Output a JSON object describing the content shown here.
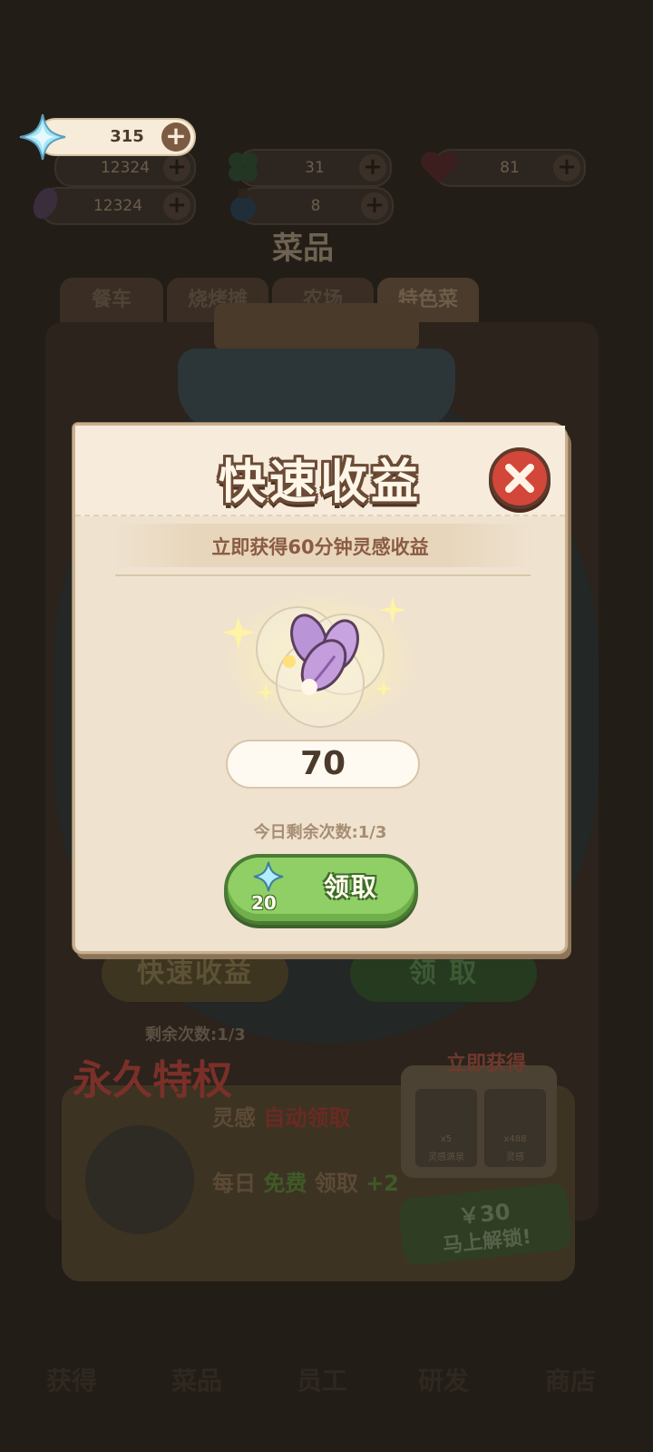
{
  "currency_top": {
    "diamonds": "315"
  },
  "background": {
    "resources": [
      {
        "name": "coins",
        "value": "12324"
      },
      {
        "name": "clover",
        "value": "31"
      },
      {
        "name": "heart",
        "value": "81"
      },
      {
        "name": "inspiration",
        "value": "12324"
      },
      {
        "name": "potion",
        "value": "8"
      }
    ],
    "section_title": "菜品",
    "tabs": [
      "餐车",
      "烧烤摊",
      "农场",
      "特色菜"
    ],
    "quick_income_button": "快速收益",
    "claim_button": "领 取",
    "remaining_count": "剩余次数:1/3",
    "promo": {
      "title": "永久特权",
      "line1_prefix": "灵感",
      "line1_highlight": "自动领取",
      "line2_prefix": "每日",
      "line2_highlight": "免费",
      "line2_mid": "领取",
      "line2_bonus": "+2",
      "instant_label": "立即获得",
      "item1_qty": "x5",
      "item1_name": "灵感源泉",
      "item2_qty": "x488",
      "item2_name": "灵感",
      "price": "￥30",
      "unlock": "马上解锁!"
    },
    "nav": [
      "获得",
      "菜品",
      "员工",
      "研发",
      "商店"
    ]
  },
  "dialog": {
    "title": "快速收益",
    "subtitle": "立即获得60分钟灵感收益",
    "amount": "70",
    "remaining": "今日剩余次数:1/3",
    "claim_label": "领取",
    "claim_cost": "20"
  },
  "colors": {
    "panel": "#efe2cf",
    "title_outline": "#6b4b36",
    "close_red": "#d3463a",
    "claim_green": "#8fcf66",
    "diamond": "#9fe3f5"
  }
}
